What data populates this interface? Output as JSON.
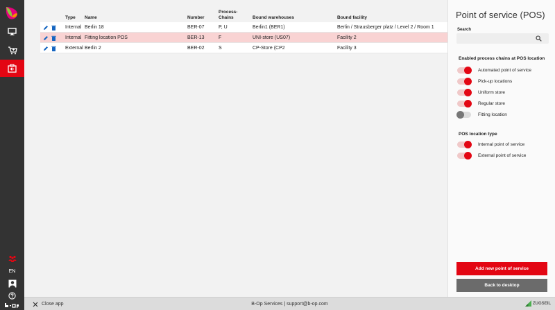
{
  "sidebar": {
    "items": [
      {
        "icon": "monitor-icon"
      },
      {
        "icon": "cart-icon"
      },
      {
        "icon": "pos-icon",
        "active": true
      }
    ],
    "language": "EN",
    "bottom_icons": [
      "people-icon",
      "user-icon",
      "help-icon",
      "bop-logo"
    ]
  },
  "table": {
    "headers": {
      "type": "Type",
      "name": "Name",
      "number": "Number",
      "process_chains": "Process-Chains",
      "bound_warehouses": "Bound warehouses",
      "bound_facility": "Bound facility"
    },
    "rows": [
      {
        "type": "Internal",
        "name": "Berlin 18",
        "number": "BER-07",
        "process_chains": "P, U",
        "bound_warehouses": "Berlin1 (BER1)",
        "bound_facility": "Berlin / Strausberger platz / Level 2 / Room 1"
      },
      {
        "type": "Internal",
        "name": "Fitting location POS",
        "number": "BER-13",
        "process_chains": "F",
        "bound_warehouses": "UNI-store (US07)",
        "bound_facility": "Facility 2",
        "selected": true
      },
      {
        "type": "External",
        "name": "Berlin 2",
        "number": "BER-02",
        "process_chains": "S",
        "bound_warehouses": "CP-Store (CP2",
        "bound_facility": "Facility 3"
      }
    ]
  },
  "panel": {
    "title": "Point of service (POS)",
    "search_label": "Search",
    "search_value": "",
    "chains_title": "Enabled process chains at POS location",
    "chains": [
      {
        "label": "Automated point of service",
        "on": true
      },
      {
        "label": "Pick-up locations",
        "on": true
      },
      {
        "label": "Uniform store",
        "on": true
      },
      {
        "label": "Regular store",
        "on": true
      },
      {
        "label": "Fitting location",
        "on": false
      }
    ],
    "type_title": "POS location type",
    "types": [
      {
        "label": "Internal point of service",
        "on": true
      },
      {
        "label": "External point of service",
        "on": true
      }
    ],
    "add_button": "Add new point of service",
    "back_button": "Back to desktop"
  },
  "footer": {
    "close_label": "Close app",
    "center_text": "B-Op Services | support@b-op.com",
    "brand": "ZUGSEIL"
  },
  "colors": {
    "accent": "#e30613",
    "rail": "#333333",
    "selected_row": "#f9d3d3"
  }
}
